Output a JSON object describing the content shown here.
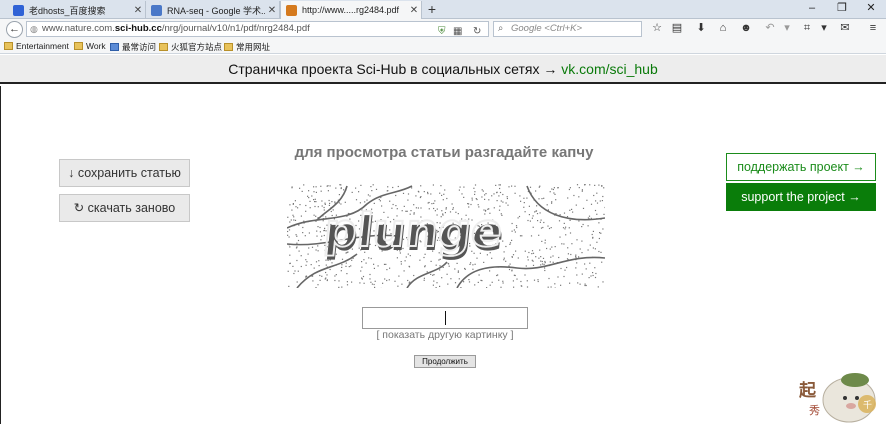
{
  "tabs": [
    {
      "title": "老dhosts_百度搜索",
      "favicon": "baidu-paw-icon",
      "color": "#2f62d6"
    },
    {
      "title": "RNA-seq - Google 学术...",
      "favicon": "google-scholar-icon",
      "color": "#4a78c8"
    },
    {
      "title": "http://www.....rg2484.pdf",
      "favicon": "scihub-raven-icon",
      "color": "#d57a1e"
    }
  ],
  "window": {
    "minimize": "‒",
    "maximize": "❐",
    "close": "✕"
  },
  "nav": {
    "url_prefix": "www.nature.com.",
    "url_domain": "sci-hub.cc",
    "url_suffix": "/nrg/journal/v10/n1/pdf/nrg2484.pdf",
    "search_placeholder": "Google <Ctrl+K>"
  },
  "bookmarks": [
    "Entertainment",
    "Work",
    "最常访问",
    "火狐官方站点",
    "常用网址"
  ],
  "banner": {
    "text": "Страничка проекта Sci-Hub в социальных сетях → ",
    "link": "vk.com/sci_hub"
  },
  "page": {
    "save_label": "↓ сохранить статью",
    "reload_label": "↻ скачать заново",
    "heading": "для просмотра статьи разгадайте капчу",
    "captcha_value": "",
    "new_picture": "[ показать другую картинку ]",
    "continue_label": "Продолжить",
    "support_ru": "поддержать проект →",
    "support_en": "support the project →"
  },
  "mascot": {
    "glyph_left": "起",
    "glyph_right": "千",
    "glyph_small": "秀"
  }
}
